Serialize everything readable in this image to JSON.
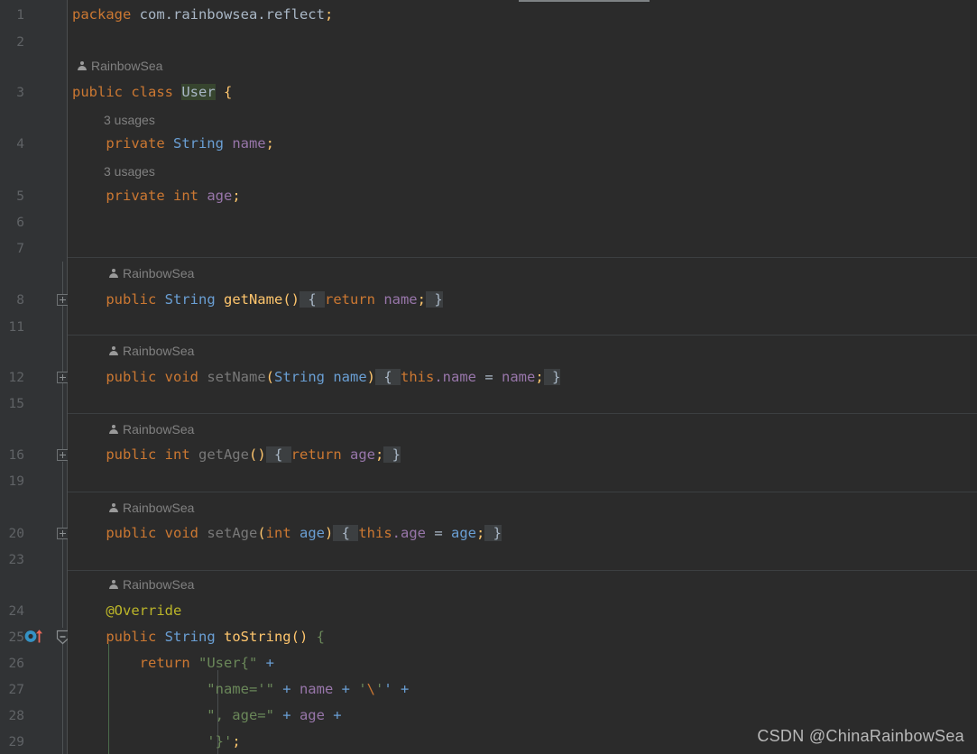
{
  "app": {
    "name": "IntelliJ IDEA Editor",
    "file_language": "Java",
    "theme": "Darcula"
  },
  "colors": {
    "editor_background": "#2b2b2b",
    "gutter_background": "#313335",
    "line_number": "#606366",
    "keyword": "#cc7832",
    "string": "#6a8759",
    "field": "#9876aa",
    "type": "#6a9fd4",
    "method_declaration": "#787878",
    "annotation": "#bbb529",
    "inlay_hint": "#808080",
    "identifier_highlight": "#37452f",
    "separator": "#3c3f41",
    "watermark": "#b9b9b9"
  },
  "editor": {
    "gutter": {
      "line_numbers": [
        "1",
        "2",
        "3",
        "4",
        "5",
        "6",
        "7",
        "8",
        "11",
        "12",
        "15",
        "16",
        "19",
        "20",
        "23",
        "24",
        "25",
        "26",
        "27",
        "28",
        "29"
      ],
      "fold_markers": [
        {
          "line": "8",
          "type": "collapsed",
          "glyph": "+"
        },
        {
          "line": "12",
          "type": "collapsed",
          "glyph": "+"
        },
        {
          "line": "16",
          "type": "collapsed",
          "glyph": "+"
        },
        {
          "line": "20",
          "type": "collapsed",
          "glyph": "+"
        },
        {
          "line": "25",
          "type": "expanded",
          "glyph": "-"
        }
      ],
      "override_marker": {
        "line": "25",
        "name": "overriding-method-icon",
        "tooltip": "Overrides method in Object"
      }
    },
    "inlay_hints": {
      "author_hint_label": "RainbowSea",
      "usage_hints": [
        "3 usages",
        "3 usages"
      ]
    },
    "lines": [
      {
        "num": "1",
        "text": "package com.rainbowsea.reflect;"
      },
      {
        "num": "2",
        "text": ""
      },
      {
        "num": "3",
        "text": "public class User {"
      },
      {
        "num": "4",
        "text": "    private String name;"
      },
      {
        "num": "5",
        "text": "    private int age;"
      },
      {
        "num": "6",
        "text": ""
      },
      {
        "num": "7",
        "text": ""
      },
      {
        "num": "8",
        "text": "    public String getName() { return name; }"
      },
      {
        "num": "11",
        "text": ""
      },
      {
        "num": "12",
        "text": "    public void setName(String name) { this.name = name; }"
      },
      {
        "num": "15",
        "text": ""
      },
      {
        "num": "16",
        "text": "    public int getAge() { return age; }"
      },
      {
        "num": "19",
        "text": ""
      },
      {
        "num": "20",
        "text": "    public void setAge(int age) { this.age = age; }"
      },
      {
        "num": "23",
        "text": ""
      },
      {
        "num": "24",
        "text": "    @Override"
      },
      {
        "num": "25",
        "text": "    public String toString() {"
      },
      {
        "num": "26",
        "text": "        return \"User{\" +"
      },
      {
        "num": "27",
        "text": "                \"name='\" + name + '\\'' +"
      },
      {
        "num": "28",
        "text": "                \", age=\" + age +"
      },
      {
        "num": "29",
        "text": "                '}';"
      }
    ]
  },
  "watermark": {
    "text": "CSDN @ChinaRainbowSea"
  }
}
